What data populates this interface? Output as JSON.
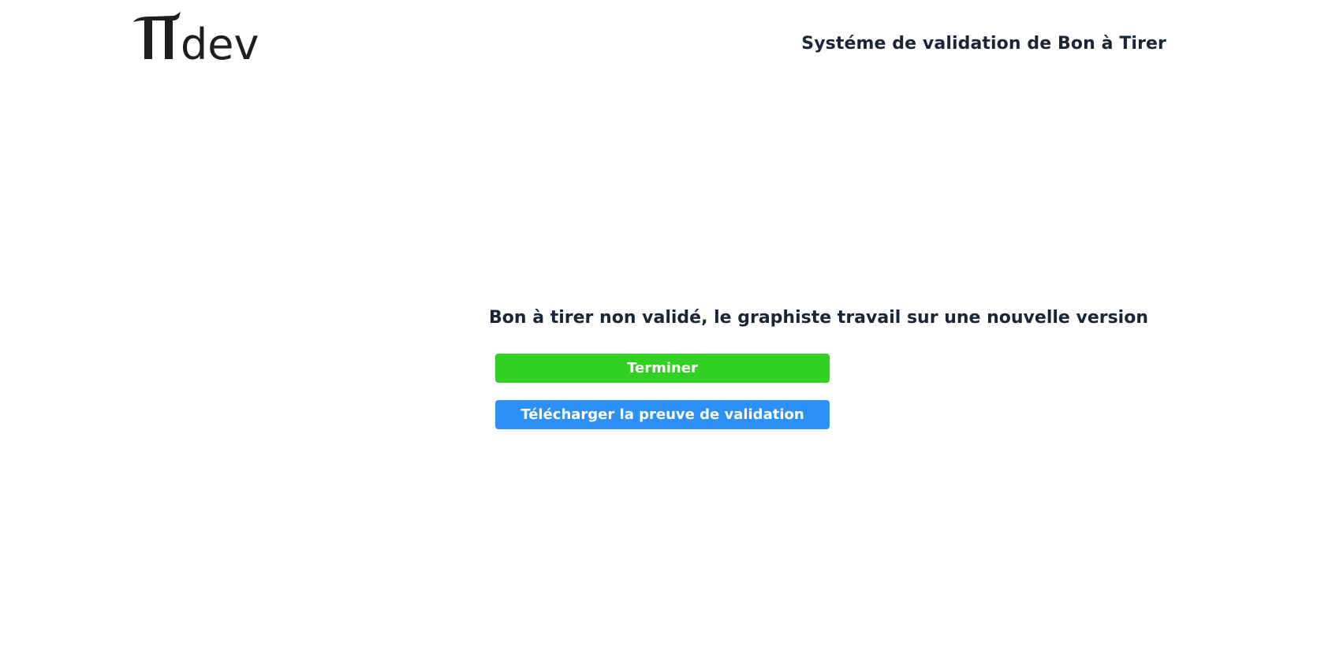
{
  "header": {
    "logo": {
      "symbol": "π",
      "wordmark": "dev",
      "icon": "pi-dev-logo",
      "color": "#1f1d1e"
    },
    "title": "Systéme de validation de Bon à Tirer"
  },
  "main": {
    "status_message": "Bon à tirer non validé, le graphiste travail sur une nouvelle version",
    "buttons": {
      "finish_label": "Terminer",
      "download_label": "Télécharger la preuve de validation"
    }
  },
  "colors": {
    "text": "#1b2535",
    "finish_button": "#31d122",
    "download_button": "#2d90f6",
    "background": "#ffffff"
  }
}
